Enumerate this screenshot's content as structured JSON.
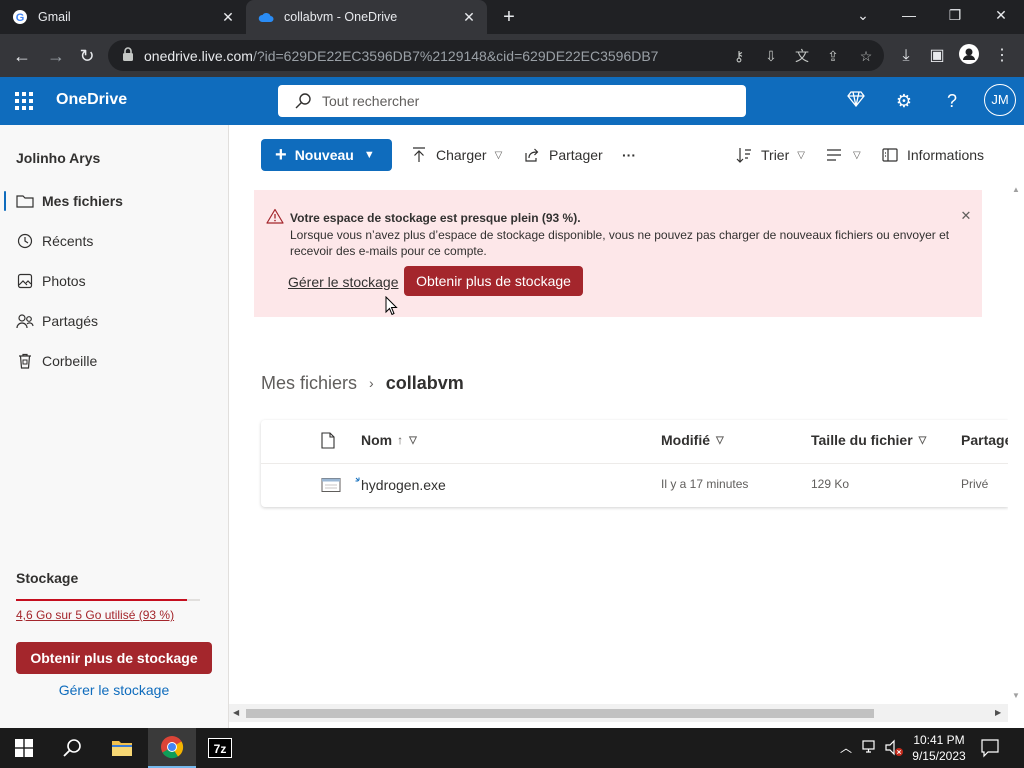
{
  "browser": {
    "tabs": [
      {
        "title": "Gmail",
        "icon": "google-icon"
      },
      {
        "title": "collabvm - OneDrive",
        "icon": "onedrive-icon"
      }
    ],
    "url_host": "onedrive.live.com",
    "url_path": "/?id=629DE22EC3596DB7%2129148&cid=629DE22EC3596DB7"
  },
  "header": {
    "brand": "OneDrive",
    "search_placeholder": "Tout rechercher",
    "avatar_initials": "JM"
  },
  "sidebar": {
    "user_name": "Jolinho Arys",
    "items": [
      {
        "label": "Mes fichiers",
        "icon": "folder-icon",
        "selected": true
      },
      {
        "label": "Récents",
        "icon": "clock-icon",
        "selected": false
      },
      {
        "label": "Photos",
        "icon": "photo-icon",
        "selected": false
      },
      {
        "label": "Partagés",
        "icon": "people-icon",
        "selected": false
      },
      {
        "label": "Corbeille",
        "icon": "trash-icon",
        "selected": false
      }
    ],
    "storage_title": "Stockage",
    "storage_used_text": "4,6 Go sur 5 Go utilisé (93 %)",
    "storage_percent": 93,
    "more_storage_label": "Obtenir plus de stockage",
    "manage_storage_label": "Gérer le stockage"
  },
  "commandbar": {
    "new_label": "Nouveau",
    "upload_label": "Charger",
    "share_label": "Partager",
    "more_label": "···",
    "sort_label": "Trier",
    "info_label": "Informations"
  },
  "banner": {
    "title": "Votre espace de stockage est presque plein (93 %).",
    "text": "Lorsque vous n’avez plus d’espace de stockage disponible, vous ne pouvez pas charger de nouveaux fichiers ou envoyer et recevoir des e-mails pour ce compte.",
    "manage_label": "Gérer le stockage",
    "more_label": "Obtenir plus de stockage"
  },
  "breadcrumb": {
    "root": "Mes fichiers",
    "separator": "›",
    "current": "collabvm"
  },
  "filelist": {
    "columns": {
      "name": "Nom",
      "sort_indicator": "↑",
      "modified": "Modifié",
      "size": "Taille du fichier",
      "sharing": "Partage"
    },
    "rows": [
      {
        "name": "hydrogen.exe",
        "modified": "Il y a 17 minutes",
        "size": "129 Ko",
        "sharing": "Privé"
      }
    ]
  },
  "taskbar": {
    "time": "10:41 PM",
    "date": "9/15/2023",
    "apps": [
      "start-icon",
      "search-icon",
      "file-explorer-icon",
      "chrome-icon",
      "7zip-icon"
    ]
  },
  "colors": {
    "brand_blue": "#0f6cbd",
    "warning_red": "#a4262c",
    "banner_bg": "#fde7e9"
  }
}
